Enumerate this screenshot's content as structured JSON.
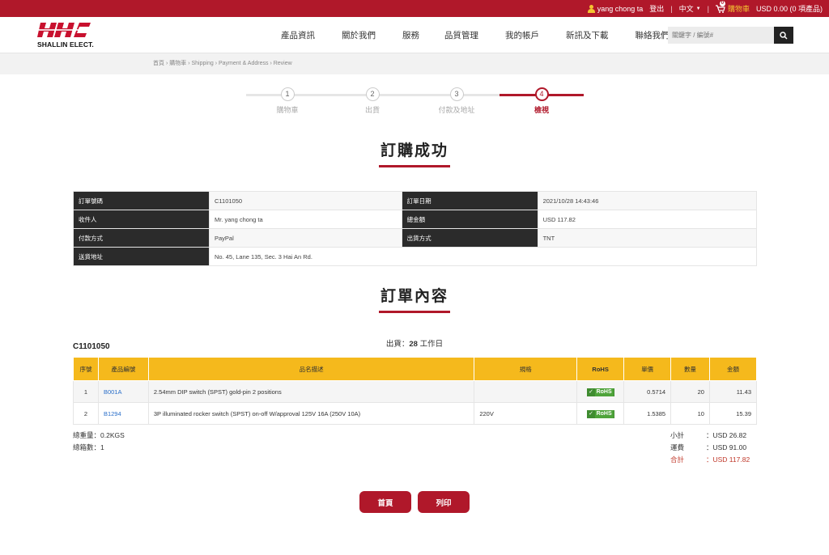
{
  "topbar": {
    "user_name": "yang chong ta",
    "logout": "登出",
    "separator": "|",
    "language": "中文",
    "cart_count": "0",
    "cart_label": "購物車",
    "cart_summary": "USD 0.00 (0 項產品)"
  },
  "header": {
    "brand_text": "SHALLIN ELECT.",
    "nav": [
      "產品資訊",
      "關於我們",
      "服務",
      "品質管理",
      "我的帳戶",
      "新訊及下載",
      "聯絡我們"
    ],
    "search_placeholder": "關鍵字 / 編號#"
  },
  "breadcrumb": [
    "首頁",
    "購物車",
    "Shipping",
    "Payment & Address",
    "Review"
  ],
  "breadcrumb_sep": "›",
  "steps": [
    {
      "num": "1",
      "label": "購物車"
    },
    {
      "num": "2",
      "label": "出貨"
    },
    {
      "num": "3",
      "label": "付款及地址"
    },
    {
      "num": "4",
      "label": "檢視"
    }
  ],
  "titles": {
    "success": "訂購成功",
    "contents": "訂單內容"
  },
  "info": {
    "order_no_label": "訂單號碼",
    "order_no": "C1101050",
    "date_label": "訂單日期",
    "date": "2021/10/28 14:43:46",
    "recipient_label": "收件人",
    "recipient": "Mr. yang chong ta",
    "total_label": "總金額",
    "total": "USD 117.82",
    "payment_label": "付款方式",
    "payment": "PayPal",
    "ship_label": "出貨方式",
    "ship": "TNT",
    "address_label": "送貨地址",
    "address": "No. 45, Lane 135, Sec. 3 Hai An Rd."
  },
  "order": {
    "number": "C1101050",
    "ship_prefix": "出貨：",
    "ship_days": "28",
    "ship_suffix": " 工作日"
  },
  "table": {
    "headers": [
      "序號",
      "產品編號",
      "品名描述",
      "規格",
      "RoHS",
      "單價",
      "數量",
      "金額"
    ],
    "rows": [
      {
        "idx": "1",
        "code": "B001A",
        "desc": "2.54mm DIP switch (SPST) gold-pin 2 positions",
        "spec": "",
        "price": "0.5714",
        "qty": "20",
        "amount": "11.43"
      },
      {
        "idx": "2",
        "code": "B1294",
        "desc": "3P illuminated rocker switch (SPST) on-off W/approval 125V 16A (250V 10A)",
        "spec": "220V",
        "price": "1.5385",
        "qty": "10",
        "amount": "15.39"
      }
    ],
    "rohs_text": "RoHS"
  },
  "summary": {
    "weight": "總重量：0.2KGS",
    "boxes": "總箱數：1",
    "subtotal_label": "小計",
    "subtotal": "：USD  26.82",
    "freight_label": "運費",
    "freight": "：USD  91.00",
    "total_label": "合計",
    "total": "：USD 117.82"
  },
  "buttons": {
    "home": "首頁",
    "print": "列印"
  },
  "colors": {
    "brand": "#b0182a",
    "table_header": "#f5b91c",
    "info_key_bg": "#2b2b2b"
  }
}
